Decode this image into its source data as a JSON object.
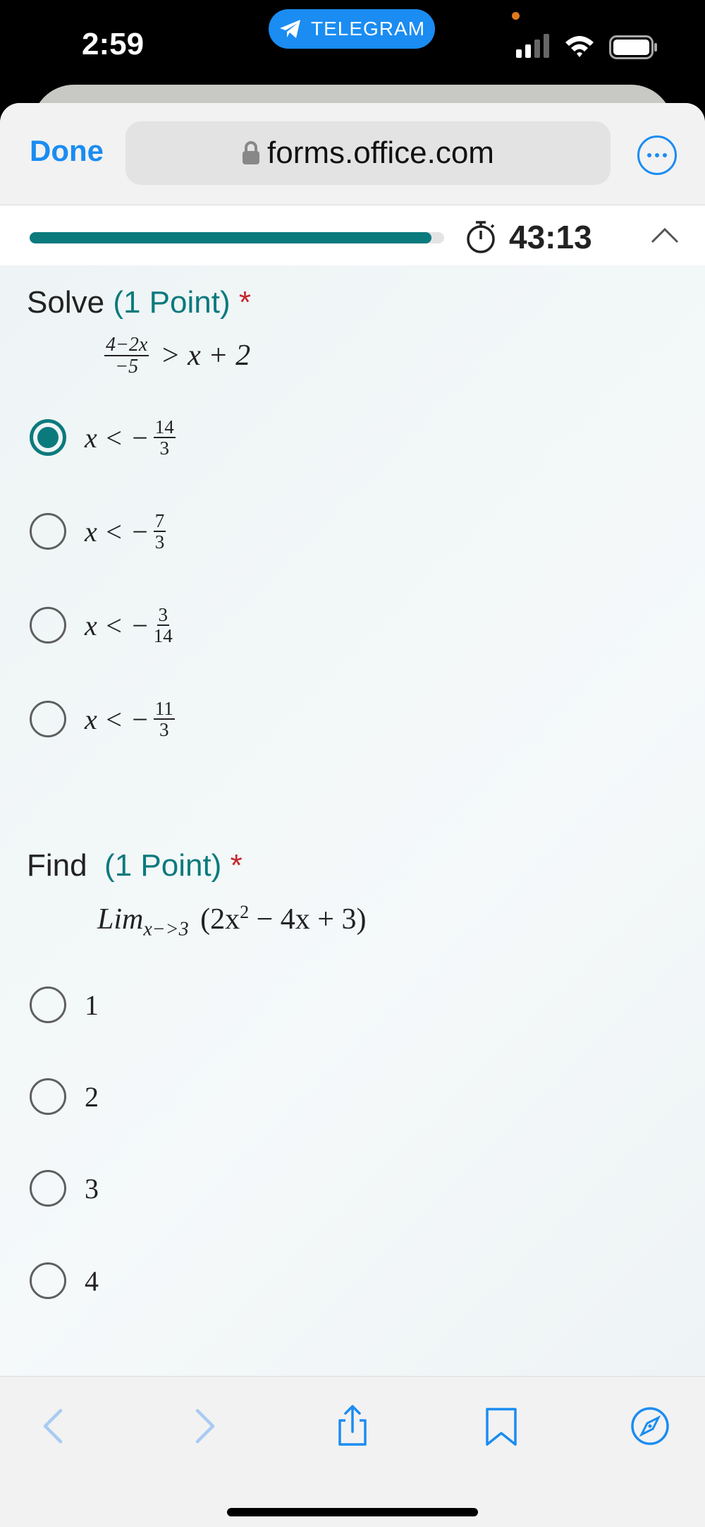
{
  "status_bar": {
    "time": "2:59",
    "telegram_label": "TELEGRAM",
    "accent_color": "#1a8cf2"
  },
  "browser": {
    "done_label": "Done",
    "url": "forms.office.com",
    "icons": [
      "lock-icon",
      "more-icon",
      "back-icon",
      "forward-icon",
      "share-icon",
      "bookmarks-icon",
      "compass-icon"
    ]
  },
  "form_header": {
    "progress": 0.97,
    "timer": "43:13",
    "accent_color": "#0b7a7d"
  },
  "questions": [
    {
      "prefix": "Solve",
      "points": "(1 Point)",
      "required_mark": "*",
      "expression": {
        "frac_num": "4−2x",
        "frac_den": "−5",
        "rest": "> x + 2"
      },
      "options": [
        {
          "lhs": "x < −",
          "num": "14",
          "den": "3",
          "selected": true
        },
        {
          "lhs": "x < −",
          "num": "7",
          "den": "3",
          "selected": false
        },
        {
          "lhs": "x < −",
          "num": "3",
          "den": "14",
          "selected": false
        },
        {
          "lhs": "x < −",
          "num": "11",
          "den": "3",
          "selected": false
        }
      ]
    },
    {
      "prefix": "Find",
      "points": "(1 Point)",
      "required_mark": "*",
      "expression": {
        "lim": "Lim",
        "sub": "x−>3",
        "body_open": "(2x",
        "sup": "2",
        "body_rest": " − 4x + 3)"
      },
      "options": [
        {
          "label": "1",
          "selected": false
        },
        {
          "label": "2",
          "selected": false
        },
        {
          "label": "3",
          "selected": false
        },
        {
          "label": "4",
          "selected": false
        }
      ]
    }
  ]
}
